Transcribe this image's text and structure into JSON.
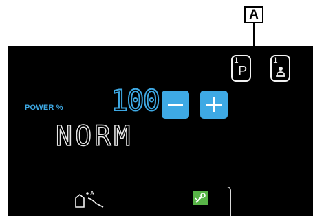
{
  "callout": {
    "label": "A"
  },
  "presets": [
    {
      "index": "1",
      "glyph": "P",
      "icon": "program-preset-icon"
    },
    {
      "index": "1",
      "glyph": "",
      "icon": "user-profile-icon"
    }
  ],
  "power": {
    "label": "POWER %",
    "value": "100",
    "decrease_icon": "minus-icon",
    "increase_icon": "plus-icon"
  },
  "mode": {
    "text": "NORM"
  },
  "bottom_bar": {
    "icons": [
      "welding-process-icon",
      "settings-tool-icon"
    ]
  },
  "colors": {
    "screen_bg": "#000000",
    "accent_blue": "#3ea9e4",
    "foreground": "#f2f2f2",
    "icon_green": "#58b447"
  }
}
